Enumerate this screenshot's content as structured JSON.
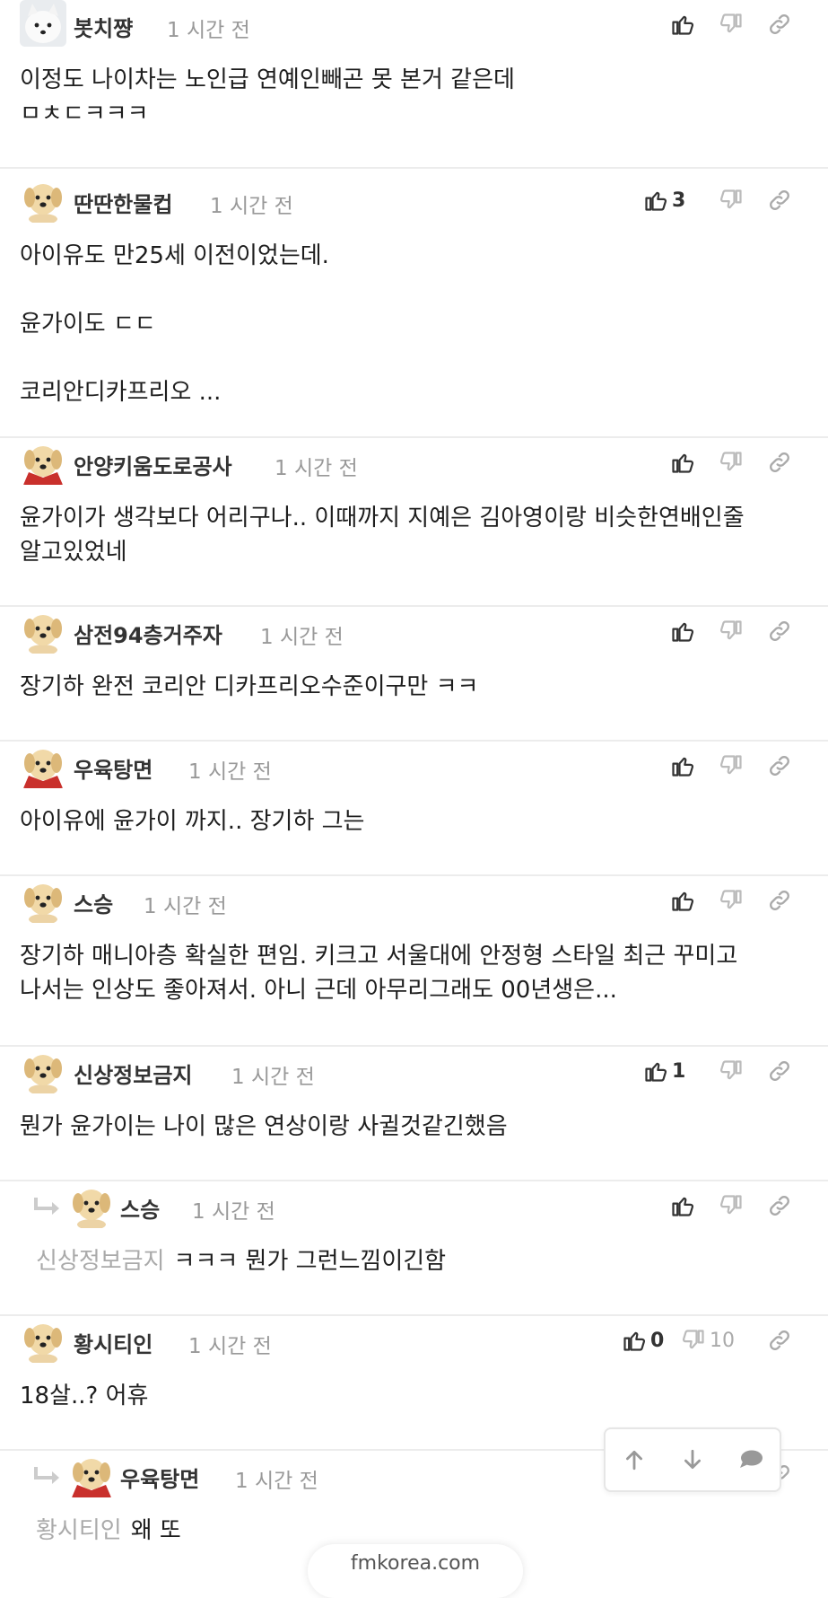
{
  "colors": {
    "text": "#1e1e1e",
    "meta": "#999999",
    "divider": "#ececec",
    "mention": "#aaaaaa"
  },
  "comments": [
    {
      "avatar": "white-dog-avatar",
      "nick": "봇치쨩",
      "time": "1 시간 전",
      "like": "",
      "dislike": "",
      "text": "이정도 나이차는 노인급 연예인빼곤 못 본거 같은데\nㅁㅊㄷㅋㅋㅋ"
    },
    {
      "avatar": "puppy-avatar",
      "nick": "딴딴한물컵",
      "time": "1 시간 전",
      "like": "3",
      "dislike": "",
      "text": "아이유도 만25세 이전이었는데.\n\n윤가이도 ㄷㄷ\n\n코리안디카프리오 ..."
    },
    {
      "avatar": "puppy-red-avatar",
      "nick": "안양키움도로공사",
      "time": "1 시간 전",
      "like": "",
      "dislike": "",
      "text": "윤가이가 생각보다 어리구나.. 이때까지 지예은 김아영이랑 비슷한연배인줄 알고있었네"
    },
    {
      "avatar": "puppy-avatar",
      "nick": "삼전94층거주자",
      "time": "1 시간 전",
      "like": "",
      "dislike": "",
      "text": "장기하 완전 코리안 디카프리오수준이구만 ㅋㅋ"
    },
    {
      "avatar": "puppy-red-avatar",
      "nick": "우육탕면",
      "time": "1 시간 전",
      "like": "",
      "dislike": "",
      "text": "아이유에 윤가이 까지.. 장기하 그는"
    },
    {
      "avatar": "puppy-avatar",
      "nick": "스승",
      "time": "1 시간 전",
      "like": "",
      "dislike": "",
      "text": "장기하 매니아층 확실한 편임. 키크고 서울대에 안정형 스타일 최근 꾸미고 나서는 인상도 좋아져서. 아니 근데 아무리그래도 00년생은..."
    },
    {
      "avatar": "puppy-avatar",
      "nick": "신상정보금지",
      "time": "1 시간 전",
      "like": "1",
      "dislike": "",
      "text": "뭔가 윤가이는 나이 많은 연상이랑 사귈것같긴했음"
    },
    {
      "avatar": "puppy-avatar",
      "nick": "스승",
      "time": "1 시간 전",
      "like": "",
      "dislike": "",
      "mention": "신상정보금지",
      "text": "ㅋㅋㅋ 뭔가 그런느낌이긴함",
      "reply": true
    },
    {
      "avatar": "puppy-avatar",
      "nick": "황시티인",
      "time": "1 시간 전",
      "like": "0",
      "dislike": "10",
      "text": "18살..? 어휴"
    },
    {
      "avatar": "puppy-red-avatar",
      "nick": "우육탕면",
      "time": "1 시간 전",
      "like": "",
      "dislike": "",
      "mention": "황시티인",
      "text": "왜 또",
      "reply": true
    }
  ],
  "bottom_pill": {
    "label": "fmkorea.com"
  }
}
